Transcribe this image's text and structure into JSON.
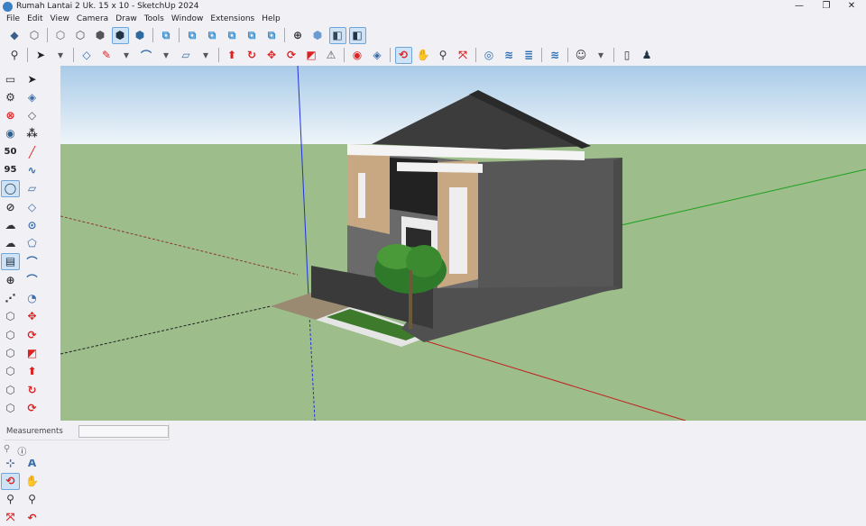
{
  "window": {
    "title": "Rumah Lantai 2 Uk. 15 x 10 - SketchUp 2024",
    "controls": [
      "minimize",
      "restore",
      "close"
    ]
  },
  "menu": [
    "File",
    "Edit",
    "View",
    "Camera",
    "Draw",
    "Tools",
    "Window",
    "Extensions",
    "Help"
  ],
  "toolbar1": [
    {
      "icon": "iso-view-icon",
      "g": "◆",
      "c": "#3a5f8a"
    },
    {
      "icon": "top-view-icon",
      "g": "⬡",
      "c": "#555"
    },
    {
      "sep": true
    },
    {
      "icon": "xray-icon",
      "g": "⬡",
      "c": "#666"
    },
    {
      "icon": "wireframe-icon",
      "g": "⬡",
      "c": "#444"
    },
    {
      "icon": "shaded-icon",
      "g": "⬢",
      "c": "#555"
    },
    {
      "icon": "shaded-textures-icon",
      "g": "⬢",
      "c": "#234",
      "on": true
    },
    {
      "icon": "monochrome-icon",
      "g": "⬢",
      "c": "#2d6a9f"
    },
    {
      "sep": true
    },
    {
      "icon": "union-icon",
      "g": "⧉",
      "c": "#3b8fd0"
    },
    {
      "sep": true
    },
    {
      "icon": "subtract-icon",
      "g": "⧉",
      "c": "#3b8fd0"
    },
    {
      "icon": "intersect-icon",
      "g": "⧉",
      "c": "#3b8fd0"
    },
    {
      "icon": "trim-icon",
      "g": "⧉",
      "c": "#3b8fd0"
    },
    {
      "icon": "split-icon",
      "g": "⧉",
      "c": "#3b8fd0"
    },
    {
      "icon": "outer-shell-icon",
      "g": "⧉",
      "c": "#3b8fd0"
    },
    {
      "sep": true
    },
    {
      "icon": "position-camera-icon",
      "g": "⊕",
      "c": "#333"
    },
    {
      "icon": "walk-icon",
      "g": "⬢",
      "c": "#6b9bd0"
    },
    {
      "icon": "section-plane-icon",
      "g": "◧",
      "c": "#345",
      "on": true
    },
    {
      "icon": "section-display-icon",
      "g": "◧",
      "c": "#234",
      "on": true
    }
  ],
  "toolbar2": [
    {
      "icon": "zoom-icon",
      "g": "⚲",
      "c": "#333"
    },
    {
      "sep": true
    },
    {
      "icon": "select-icon",
      "g": "➤",
      "c": "#222"
    },
    {
      "icon": "chevron-down-icon",
      "g": "▾",
      "c": "#555"
    },
    {
      "sep": true
    },
    {
      "icon": "eraser-icon",
      "g": "◇",
      "c": "#2a6db5"
    },
    {
      "icon": "pencil-icon",
      "g": "✎",
      "c": "#d22"
    },
    {
      "icon": "chevron-down-icon",
      "g": "▾",
      "c": "#555"
    },
    {
      "icon": "arc-icon",
      "g": "⌒",
      "c": "#3a6ca8"
    },
    {
      "icon": "chevron-down-icon",
      "g": "▾",
      "c": "#555"
    },
    {
      "icon": "rectangle-icon",
      "g": "▱",
      "c": "#3a6ca8"
    },
    {
      "icon": "chevron-down-icon",
      "g": "▾",
      "c": "#555"
    },
    {
      "sep": true
    },
    {
      "icon": "push-pull-icon",
      "g": "⬆",
      "c": "#d22"
    },
    {
      "icon": "follow-me-icon",
      "g": "↻",
      "c": "#d22"
    },
    {
      "icon": "move-icon",
      "g": "✥",
      "c": "#d22"
    },
    {
      "icon": "rotate-icon",
      "g": "⟳",
      "c": "#d22"
    },
    {
      "icon": "scale-icon",
      "g": "◩",
      "c": "#d22"
    },
    {
      "icon": "offset-icon",
      "g": "⚠",
      "c": "#555"
    },
    {
      "sep": true
    },
    {
      "icon": "tape-measure-icon",
      "g": "◉",
      "c": "#d22"
    },
    {
      "icon": "paint-bucket-icon",
      "g": "◈",
      "c": "#3a6ca8"
    },
    {
      "sep": true
    },
    {
      "icon": "orbit-icon",
      "g": "⟲",
      "c": "#d22",
      "on": true
    },
    {
      "icon": "pan-icon",
      "g": "✋",
      "c": "#c33"
    },
    {
      "icon": "zoom-tool-icon",
      "g": "⚲",
      "c": "#333"
    },
    {
      "icon": "zoom-extents-icon",
      "g": "⤧",
      "c": "#d22"
    },
    {
      "sep": true
    },
    {
      "icon": "3d-warehouse-icon",
      "g": "◎",
      "c": "#2a6db5"
    },
    {
      "icon": "extension-warehouse-icon",
      "g": "≋",
      "c": "#2a6db5"
    },
    {
      "icon": "layout-icon",
      "g": "≣",
      "c": "#2a6db5"
    },
    {
      "sep": true
    },
    {
      "icon": "extension-manager-icon",
      "g": "≋",
      "c": "#2a6db5"
    },
    {
      "sep": true
    },
    {
      "icon": "profile-icon",
      "g": "☺",
      "c": "#333"
    },
    {
      "icon": "chevron-down-icon",
      "g": "▾",
      "c": "#555"
    },
    {
      "sep": true
    },
    {
      "icon": "new-file-icon",
      "g": "▯",
      "c": "#333"
    },
    {
      "icon": "user-icon",
      "g": "♟",
      "c": "#234"
    }
  ],
  "left_toolbar": [
    {
      "icon": "open-icon",
      "g": "▭",
      "c": "#333"
    },
    {
      "icon": "select-icon",
      "g": "➤",
      "c": "#222"
    },
    {
      "icon": "settings-icon",
      "g": "⚙",
      "c": "#333"
    },
    {
      "icon": "paint-icon",
      "g": "◈",
      "c": "#3a6ca8"
    },
    {
      "icon": "remove-icon",
      "g": "⊗",
      "c": "#d22"
    },
    {
      "icon": "eraser-icon",
      "g": "◇",
      "c": "#555"
    },
    {
      "icon": "eye-icon",
      "g": "◉",
      "c": "#2a5f8f"
    },
    {
      "icon": "component-icon",
      "g": "⁂",
      "c": "#333"
    },
    {
      "icon": "50-icon",
      "g": "50",
      "c": "#222"
    },
    {
      "icon": "line-icon",
      "g": "╱",
      "c": "#d22"
    },
    {
      "icon": "95-icon",
      "g": "95",
      "c": "#222"
    },
    {
      "icon": "freehand-icon",
      "g": "∿",
      "c": "#3a6ca8"
    },
    {
      "icon": "circle-tool-icon",
      "g": "◯",
      "c": "#234",
      "on": true
    },
    {
      "icon": "rectangle-icon",
      "g": "▱",
      "c": "#3a6ca8"
    },
    {
      "icon": "hatch-icon",
      "g": "⊘",
      "c": "#333"
    },
    {
      "icon": "rotated-rect-icon",
      "g": "◇",
      "c": "#3a6ca8"
    },
    {
      "icon": "cloud-up-icon",
      "g": "☁",
      "c": "#333"
    },
    {
      "icon": "circle-icon",
      "g": "⊙",
      "c": "#3a6ca8"
    },
    {
      "icon": "cloud-down-icon",
      "g": "☁",
      "c": "#333"
    },
    {
      "icon": "polygon-icon",
      "g": "⬠",
      "c": "#3a6ca8"
    },
    {
      "icon": "layers-icon",
      "g": "▤",
      "c": "#234",
      "on": true
    },
    {
      "icon": "arc-icon",
      "g": "⌒",
      "c": "#3a6ca8"
    },
    {
      "icon": "add-icon",
      "g": "⊕",
      "c": "#333"
    },
    {
      "icon": "arc2-icon",
      "g": "⌒",
      "c": "#3a6ca8"
    },
    {
      "icon": "dashed-line-icon",
      "g": "⋰",
      "c": "#333"
    },
    {
      "icon": "pie-icon",
      "g": "◔",
      "c": "#3a6ca8"
    },
    {
      "icon": "shape1-icon",
      "g": "⬡",
      "c": "#555"
    },
    {
      "icon": "move-icon",
      "g": "✥",
      "c": "#d22"
    },
    {
      "icon": "shape2-icon",
      "g": "⬡",
      "c": "#555"
    },
    {
      "icon": "rotate-icon",
      "g": "⟳",
      "c": "#d22"
    },
    {
      "icon": "shape3-icon",
      "g": "⬡",
      "c": "#555"
    },
    {
      "icon": "scale-icon",
      "g": "◩",
      "c": "#d22"
    },
    {
      "icon": "shape4-icon",
      "g": "⬡",
      "c": "#555"
    },
    {
      "icon": "push-pull-icon",
      "g": "⬆",
      "c": "#d22"
    },
    {
      "icon": "shape5-icon",
      "g": "⬡",
      "c": "#555"
    },
    {
      "icon": "follow-me-icon",
      "g": "↻",
      "c": "#d22"
    },
    {
      "icon": "shape6-icon",
      "g": "⬡",
      "c": "#555"
    },
    {
      "icon": "offset-icon",
      "g": "⟳",
      "c": "#d22"
    },
    {
      "icon": "shape7-icon",
      "g": "⬡",
      "c": "#555"
    },
    {
      "icon": "tape-icon",
      "g": "◉",
      "c": "#d22"
    },
    {
      "icon": "text-icon",
      "g": "A",
      "c": "#333"
    },
    {
      "icon": "protractor-icon",
      "g": "◐",
      "c": "#3a6ca8"
    },
    {
      "icon": "axes-icon",
      "g": "⊹",
      "c": "#3a6ca8"
    },
    {
      "icon": "dimension-icon",
      "g": "A",
      "c": "#3a6ca8"
    },
    {
      "icon": "orbit-icon",
      "g": "⟲",
      "c": "#d22",
      "on": true
    },
    {
      "icon": "pan-icon",
      "g": "✋",
      "c": "#c33"
    },
    {
      "icon": "zoom-icon",
      "g": "⚲",
      "c": "#333"
    },
    {
      "icon": "zoom-window-icon",
      "g": "⚲",
      "c": "#333"
    },
    {
      "icon": "zoom-extents-icon",
      "g": "⤧",
      "c": "#d22"
    },
    {
      "icon": "previous-icon",
      "g": "↶",
      "c": "#d22"
    }
  ],
  "measurements": {
    "label": "Measurements",
    "value": ""
  },
  "status_icons": [
    "geo-location-icon",
    "info-icon"
  ]
}
